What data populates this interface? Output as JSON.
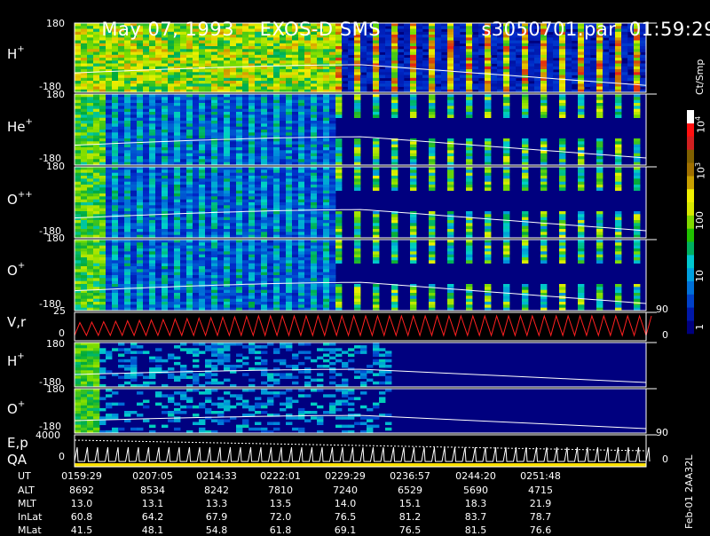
{
  "header": {
    "date": "May 07, 1993",
    "instrument": "EXOS-D SMS",
    "file": "s3050701.par",
    "time": "01:59:29"
  },
  "colorbar": {
    "unit": "Ct/Smp",
    "ticks": [
      "1",
      "10",
      "100",
      "10",
      "10"
    ],
    "exp_ticks": [
      "3",
      "4"
    ]
  },
  "side_label": "Feb-01 2AA32L",
  "colors": {
    "background": "#000000",
    "spectrogram_base": "#00007f",
    "ve_trace": "#ff2020",
    "bottom_strip": "#ffe000"
  },
  "chart_data": {
    "type": "heatmap",
    "title": "May 07, 1993   EXOS-D SMS",
    "x_axis": "UT",
    "panels": [
      {
        "label": "H",
        "sup": "+",
        "scale": "log",
        "ylim": [
          -180,
          180
        ],
        "yticks": [
          "180",
          "-180"
        ]
      },
      {
        "label": "He",
        "sup": "+",
        "scale": "log",
        "ylim": [
          -180,
          180
        ],
        "yticks": [
          "180",
          "-180"
        ]
      },
      {
        "label": "O",
        "sup": "++",
        "scale": "log",
        "ylim": [
          -180,
          180
        ],
        "yticks": [
          "180",
          "-180"
        ]
      },
      {
        "label": "O",
        "sup": "+",
        "scale": "log",
        "ylim": [
          -180,
          180
        ],
        "yticks": [
          "180",
          "-180"
        ],
        "right_tick": "90"
      },
      {
        "label": "V,r",
        "sup": "",
        "ylim": [
          0,
          25
        ],
        "yticks": [
          "25",
          "0"
        ],
        "right_ticks": [
          "0"
        ]
      },
      {
        "label": "H",
        "sup": "+",
        "ylim": [
          -180,
          180
        ],
        "yticks": [
          "180",
          "-180"
        ]
      },
      {
        "label": "O",
        "sup": "+",
        "ylim": [
          -180,
          180
        ],
        "yticks": [
          "180",
          "-180"
        ],
        "right_tick": "90"
      },
      {
        "label": "E,p",
        "sup": "",
        "label2": "QA",
        "ylim": [
          0,
          4000
        ],
        "yticks": [
          "4000",
          "0"
        ],
        "right_ticks": [
          "0"
        ]
      }
    ],
    "orbit": {
      "rows": [
        "UT",
        "ALT",
        "MLT",
        "InLat",
        "MLat"
      ],
      "columns": [
        {
          "UT": "0159:29",
          "ALT": "8692",
          "MLT": "13.0",
          "InLat": "60.8",
          "MLat": "41.5"
        },
        {
          "UT": "0207:05",
          "ALT": "8534",
          "MLT": "13.1",
          "InLat": "64.2",
          "MLat": "48.1"
        },
        {
          "UT": "0214:33",
          "ALT": "8242",
          "MLT": "13.3",
          "InLat": "67.9",
          "MLat": "54.8"
        },
        {
          "UT": "0222:01",
          "ALT": "7810",
          "MLT": "13.5",
          "InLat": "72.0",
          "MLat": "61.8"
        },
        {
          "UT": "0229:29",
          "ALT": "7240",
          "MLT": "14.0",
          "InLat": "76.5",
          "MLat": "69.1"
        },
        {
          "UT": "0236:57",
          "ALT": "6529",
          "MLT": "15.1",
          "InLat": "81.2",
          "MLat": "76.5"
        },
        {
          "UT": "0244:20",
          "ALT": "5690",
          "MLT": "18.3",
          "InLat": "83.7",
          "MLat": "81.5"
        },
        {
          "UT": "0251:48",
          "ALT": "4715",
          "MLT": "21.9",
          "InLat": "78.7",
          "MLat": "76.6"
        }
      ]
    }
  }
}
